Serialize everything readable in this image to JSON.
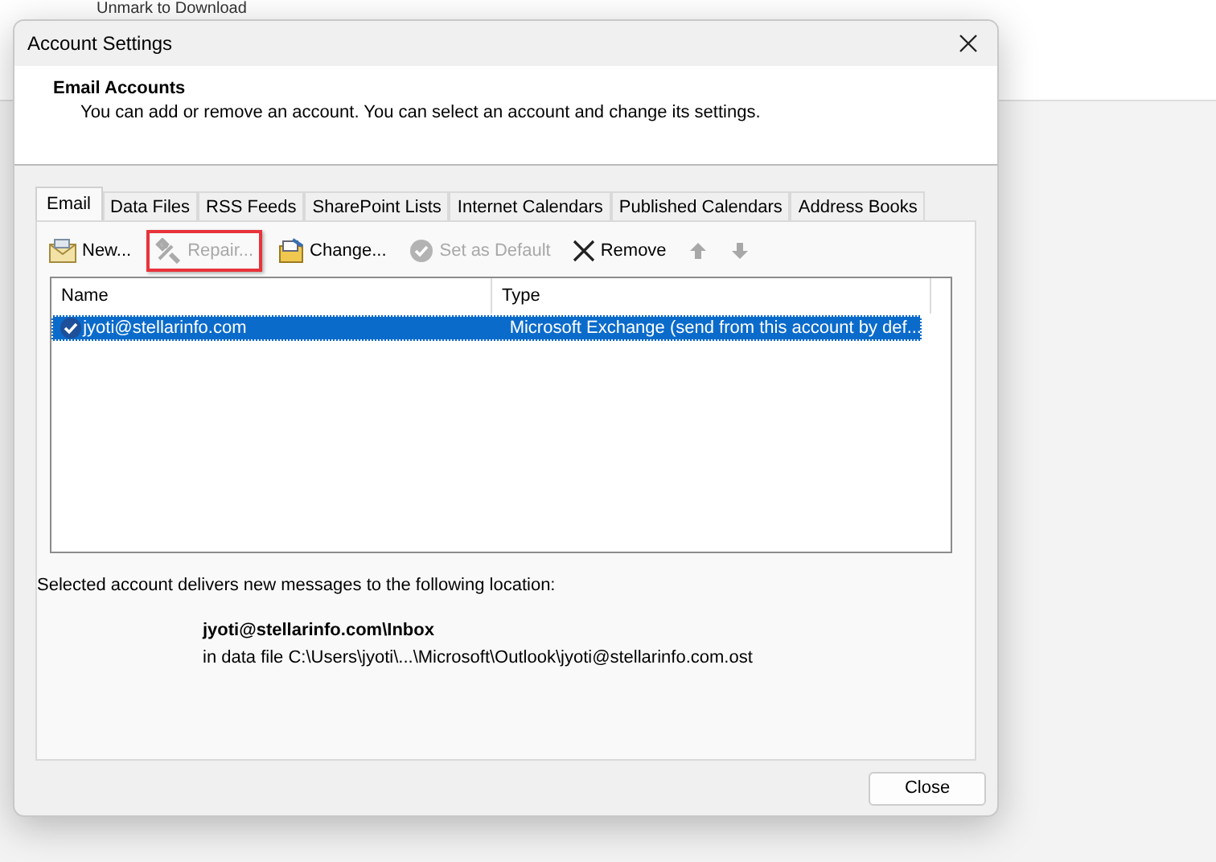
{
  "background": {
    "ribbon_item": "Unmark to Download"
  },
  "window": {
    "title": "Account Settings"
  },
  "header": {
    "title": "Email Accounts",
    "description": "You can add or remove an account. You can select an account and change its settings."
  },
  "tabs": [
    {
      "label": "Email",
      "selected": true
    },
    {
      "label": "Data Files",
      "selected": false
    },
    {
      "label": "RSS Feeds",
      "selected": false
    },
    {
      "label": "SharePoint Lists",
      "selected": false
    },
    {
      "label": "Internet Calendars",
      "selected": false
    },
    {
      "label": "Published Calendars",
      "selected": false
    },
    {
      "label": "Address Books",
      "selected": false
    }
  ],
  "toolbar": [
    {
      "kind": "new",
      "label": "New...",
      "disabled": false,
      "highlighted": false
    },
    {
      "kind": "repair",
      "label": "Repair...",
      "disabled": true,
      "highlighted": true
    },
    {
      "kind": "change",
      "label": "Change...",
      "disabled": false,
      "highlighted": false
    },
    {
      "kind": "default",
      "label": "Set as Default",
      "disabled": true,
      "highlighted": false
    },
    {
      "kind": "remove",
      "label": "Remove",
      "disabled": false,
      "highlighted": false
    },
    {
      "kind": "up",
      "disabled": true,
      "highlighted": false
    },
    {
      "kind": "down",
      "disabled": true,
      "highlighted": false
    }
  ],
  "table": {
    "columns": [
      "Name",
      "Type"
    ],
    "rows": [
      {
        "name": "jyoti@stellarinfo.com",
        "type": "Microsoft Exchange (send from this account by def...",
        "selected": true,
        "default": true
      }
    ]
  },
  "delivery": {
    "label": "Selected account delivers new messages to the following location:",
    "location": "jyoti@stellarinfo.com\\Inbox",
    "data_file": "in data file C:\\Users\\jyoti\\...\\Microsoft\\Outlook\\jyoti@stellarinfo.com.ost"
  },
  "buttons": [
    "Close"
  ]
}
